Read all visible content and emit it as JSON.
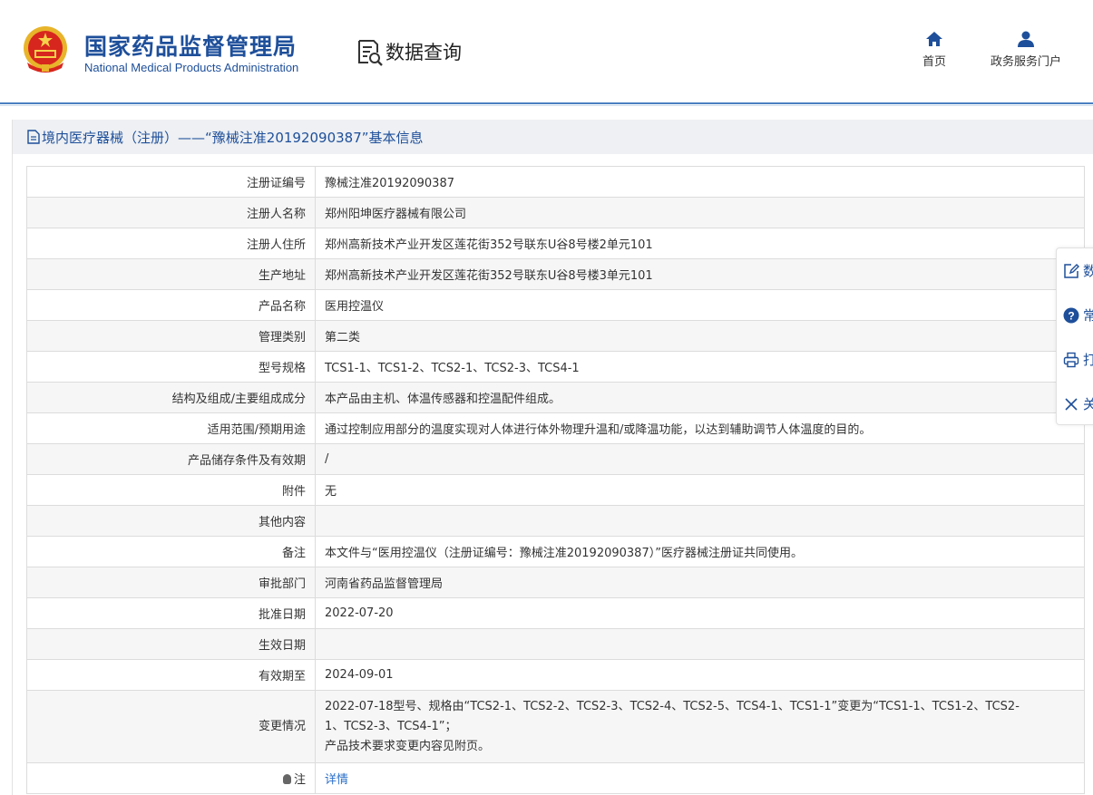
{
  "header": {
    "brand_cn": "国家药品监督管理局",
    "brand_en": "National Medical Products Administration",
    "query_label": "数据查询",
    "nav": [
      {
        "label": "首页",
        "icon": "home-icon"
      },
      {
        "label": "政务服务门户",
        "icon": "user-icon"
      }
    ],
    "colors": {
      "brand": "#1e4f9a",
      "accent": "#2a6fc9",
      "emblem_red": "#d7261e",
      "emblem_gold": "#f2c12e"
    }
  },
  "panel": {
    "title": "境内医疗器械（注册）——“豫械注准20192090387”基本信息",
    "rows": [
      {
        "key": "注册证编号",
        "value": "豫械注准20192090387"
      },
      {
        "key": "注册人名称",
        "value": "郑州阳坤医疗器械有限公司"
      },
      {
        "key": "注册人住所",
        "value": "郑州高新技术产业开发区莲花街352号联东U谷8号楼2单元101"
      },
      {
        "key": "生产地址",
        "value": "郑州高新技术产业开发区莲花街352号联东U谷8号楼3单元101"
      },
      {
        "key": "产品名称",
        "value": "医用控温仪"
      },
      {
        "key": "管理类别",
        "value": "第二类"
      },
      {
        "key": "型号规格",
        "value": "TCS1-1、TCS1-2、TCS2-1、TCS2-3、TCS4-1"
      },
      {
        "key": "结构及组成/主要组成成分",
        "value": "本产品由主机、体温传感器和控温配件组成。"
      },
      {
        "key": "适用范围/预期用途",
        "value": "通过控制应用部分的温度实现对人体进行体外物理升温和/或降温功能，以达到辅助调节人体温度的目的。"
      },
      {
        "key": "产品储存条件及有效期",
        "value": "/"
      },
      {
        "key": "附件",
        "value": "无"
      },
      {
        "key": "其他内容",
        "value": ""
      },
      {
        "key": "备注",
        "value": "本文件与“医用控温仪（注册证编号：豫械注准20192090387）”医疗器械注册证共同使用。"
      },
      {
        "key": "审批部门",
        "value": "河南省药品监督管理局"
      },
      {
        "key": "批准日期",
        "value": "2022-07-20"
      },
      {
        "key": "生效日期",
        "value": ""
      },
      {
        "key": "有效期至",
        "value": "2024-09-01"
      }
    ],
    "change": {
      "key": "变更情况",
      "line1": "2022-07-18型号、规格由“TCS2-1、TCS2-2、TCS2-3、TCS2-4、TCS2-5、TCS4-1、TCS1-1”变更为“TCS1-1、TCS1-2、TCS2-",
      "line2": "1、TCS2-3、TCS4-1”；",
      "line3": "产品技术要求变更内容见附页。"
    },
    "note": {
      "key": "注",
      "link": "详情"
    }
  },
  "sidebar": {
    "items": [
      {
        "label": "数",
        "icon": "edit-icon"
      },
      {
        "label": "常",
        "icon": "help-icon"
      },
      {
        "label": "打",
        "icon": "print-icon"
      },
      {
        "label": "关",
        "icon": "close-icon"
      }
    ]
  }
}
